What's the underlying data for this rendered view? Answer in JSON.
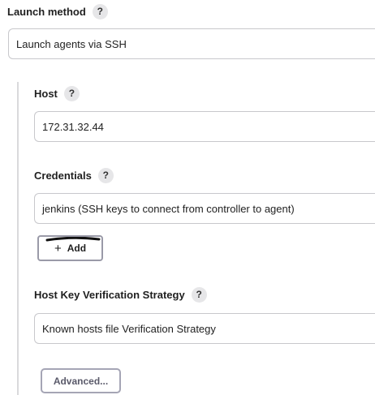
{
  "launch_method": {
    "label": "Launch method",
    "help": "?",
    "value": "Launch agents via SSH"
  },
  "ssh": {
    "host": {
      "label": "Host",
      "help": "?",
      "value": "172.31.32.44"
    },
    "credentials": {
      "label": "Credentials",
      "help": "?",
      "value": "jenkins (SSH keys to connect from controller to agent)",
      "add_button": {
        "icon": "+",
        "label": "Add"
      }
    },
    "host_key_verification": {
      "label": "Host Key Verification Strategy",
      "help": "?",
      "value": "Known hosts file Verification Strategy"
    },
    "advanced_button": {
      "label": "Advanced..."
    }
  }
}
